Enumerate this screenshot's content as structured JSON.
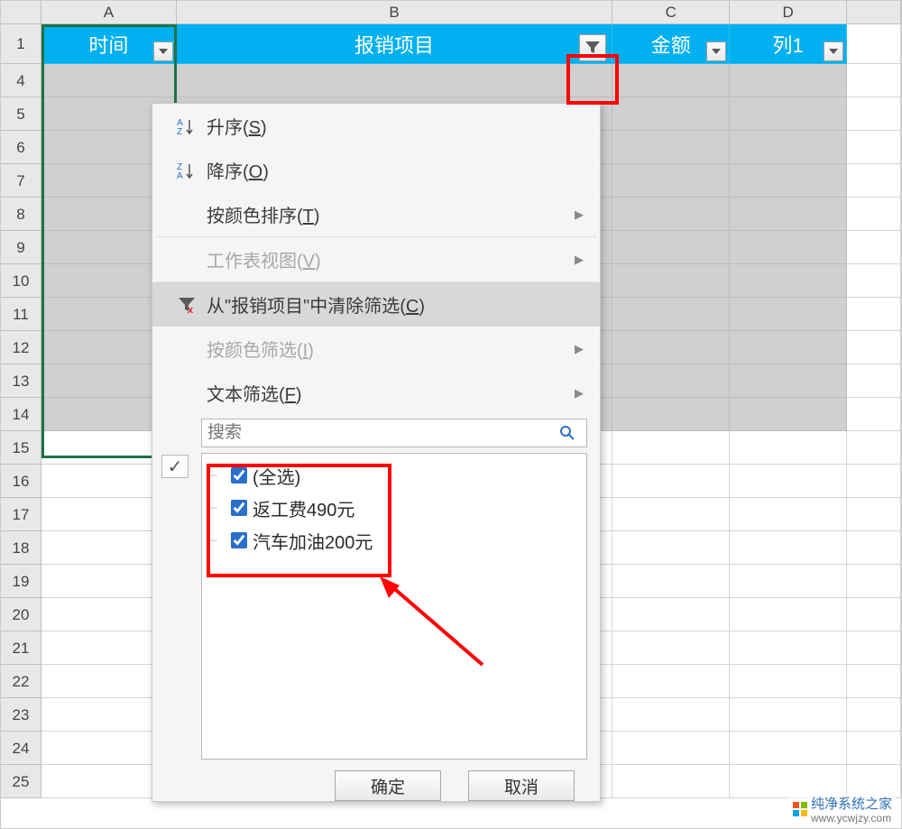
{
  "columns": {
    "A": "A",
    "B": "B",
    "C": "C",
    "D": "D"
  },
  "table_header": {
    "colA": "时间",
    "colB": "报销项目",
    "colC": "金额",
    "colD": "列1"
  },
  "row_numbers": [
    "1",
    "4",
    "5",
    "6",
    "7",
    "8",
    "9",
    "10",
    "11",
    "12",
    "13",
    "14",
    "15",
    "16",
    "17",
    "18",
    "19",
    "20",
    "21",
    "22",
    "23",
    "24",
    "25"
  ],
  "filter_menu": {
    "sort_asc": {
      "label_pre": "升序(",
      "hotkey": "S",
      "label_post": ")"
    },
    "sort_desc": {
      "label_pre": "降序(",
      "hotkey": "O",
      "label_post": ")"
    },
    "sort_by_color": {
      "label_pre": "按颜色排序(",
      "hotkey": "T",
      "label_post": ")"
    },
    "sheet_view": {
      "label_pre": "工作表视图(",
      "hotkey": "V",
      "label_post": ")"
    },
    "clear_filter": {
      "label_pre": "从\"报销项目\"中清除筛选(",
      "hotkey": "C",
      "label_post": ")"
    },
    "filter_by_color": {
      "label_pre": "按颜色筛选(",
      "hotkey": "I",
      "label_post": ")"
    },
    "text_filter": {
      "label_pre": "文本筛选(",
      "hotkey": "F",
      "label_post": ")"
    },
    "search_placeholder": "搜索",
    "items": {
      "select_all": "(全选)",
      "item1": "返工费490元",
      "item2": "汽车加油200元"
    },
    "ok": "确定",
    "cancel": "取消"
  },
  "watermark": {
    "title": "纯净系统之家",
    "url": "www.ycwjzy.com"
  }
}
